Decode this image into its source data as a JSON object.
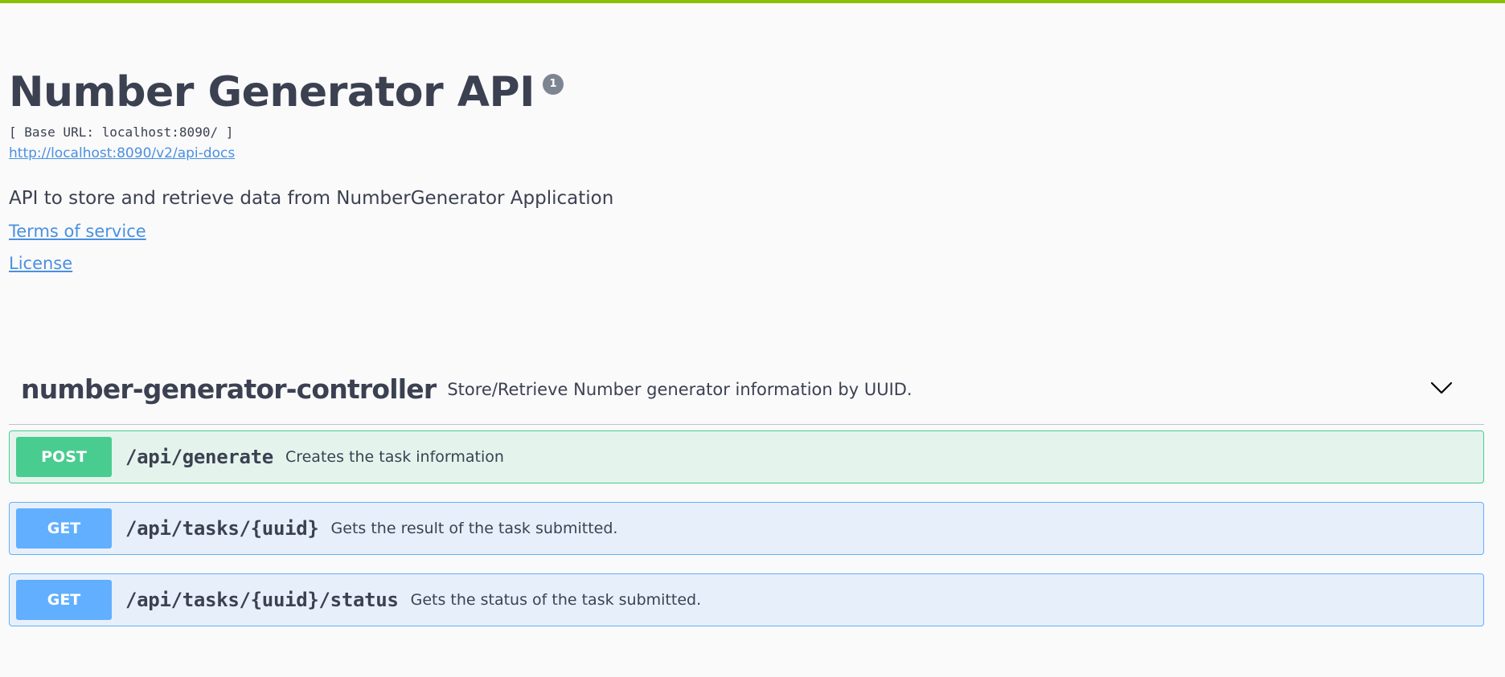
{
  "info": {
    "title": "Number Generator API",
    "version": "1",
    "base_url": "[ Base URL: localhost:8090/ ]",
    "spec_url": "http://localhost:8090/v2/api-docs",
    "description": "API to store and retrieve data from NumberGenerator Application",
    "terms_label": "Terms of service",
    "license_label": "License"
  },
  "tag": {
    "name": "number-generator-controller",
    "description": "Store/Retrieve Number generator information by UUID.",
    "toggle_icon": "chevron-down-icon"
  },
  "operations": [
    {
      "method": "POST",
      "path": "/api/generate",
      "summary": "Creates the task information"
    },
    {
      "method": "GET",
      "path": "/api/tasks/{uuid}",
      "summary": "Gets the result of the task submitted."
    },
    {
      "method": "GET",
      "path": "/api/tasks/{uuid}/status",
      "summary": "Gets the status of the task submitted."
    }
  ],
  "colors": {
    "accent": "#89bf04",
    "post": "#49cc90",
    "get": "#61affe",
    "link": "#4990e2",
    "text": "#3b4151"
  }
}
